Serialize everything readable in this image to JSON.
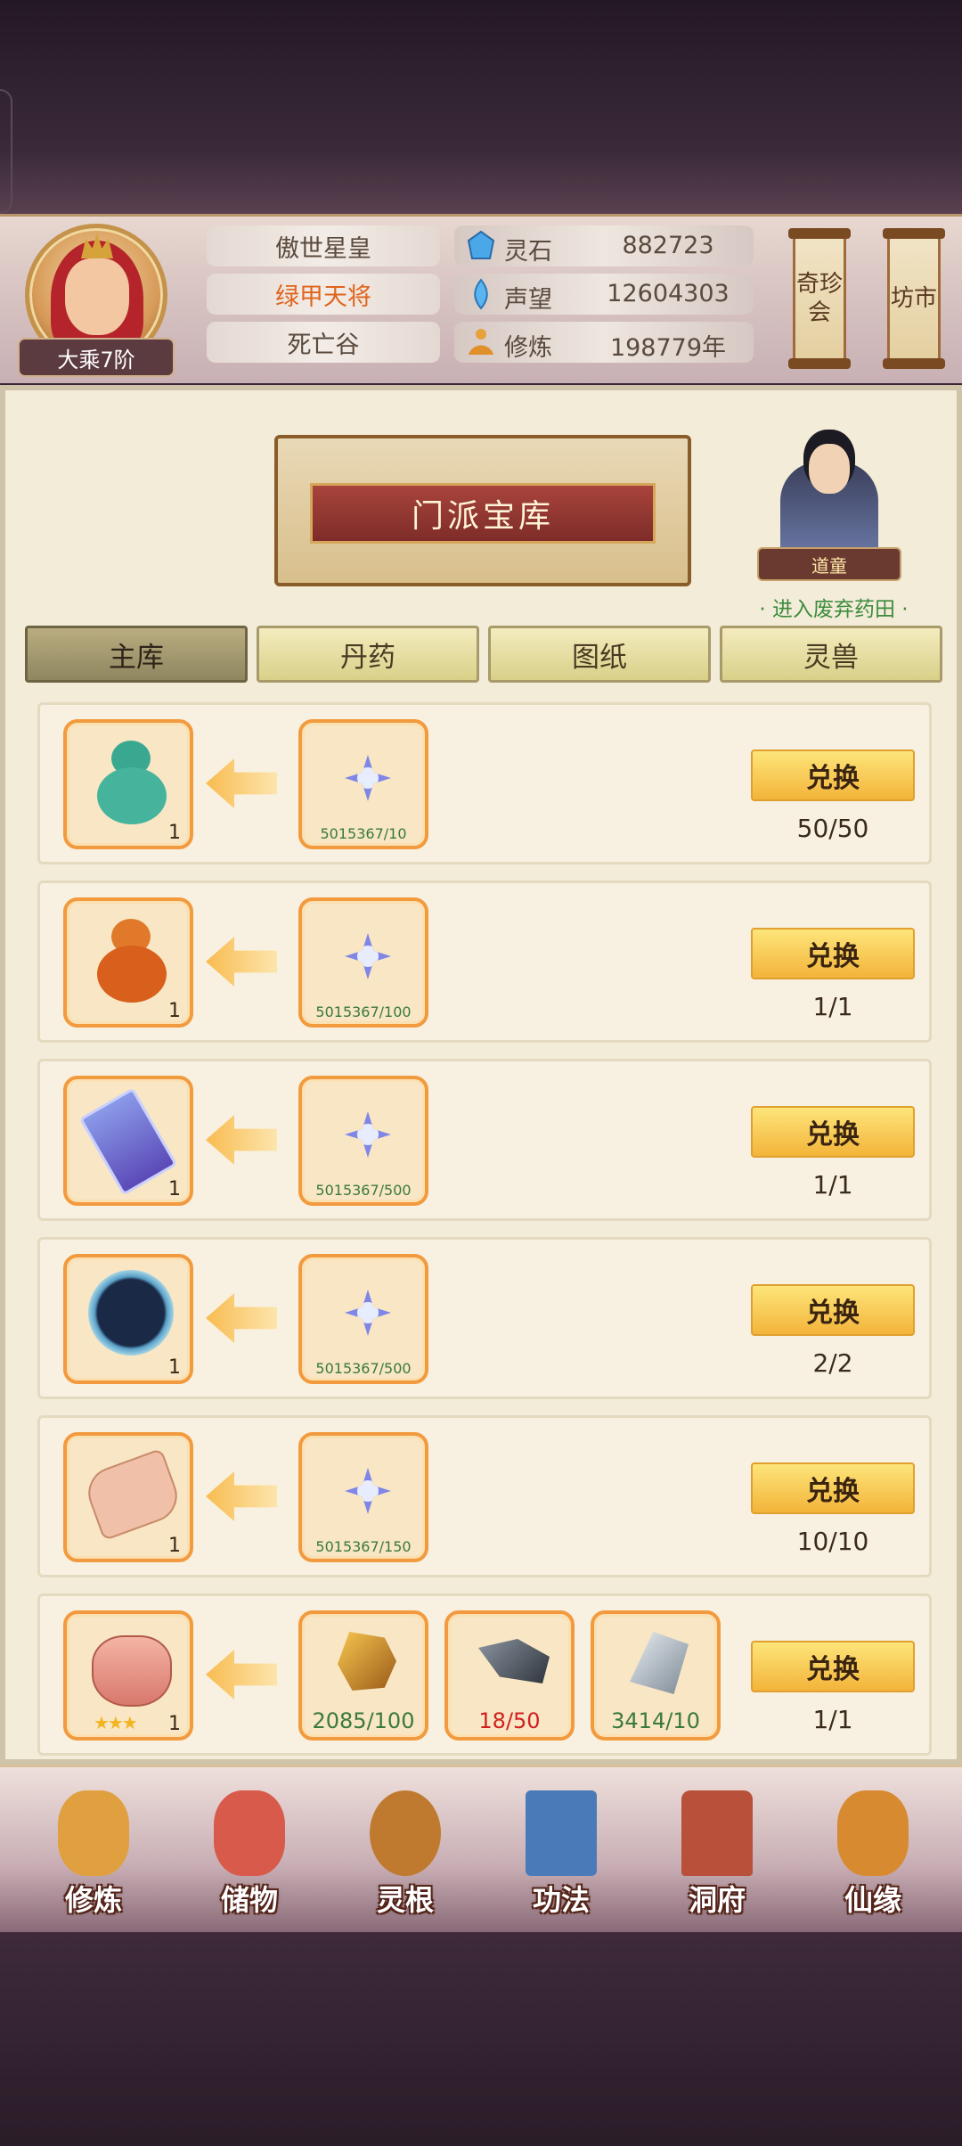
{
  "player": {
    "rank": "大乘7阶",
    "name": "傲世星皇",
    "title": "绿甲天将",
    "location": "死亡谷"
  },
  "stats": [
    {
      "label": "灵石",
      "value": "882723",
      "icon": "spirit-stone-icon"
    },
    {
      "label": "声望",
      "value": "12604303",
      "icon": "reputation-icon"
    },
    {
      "label": "修炼",
      "value": "198779年",
      "icon": "cultivation-icon"
    }
  ],
  "side_buttons": [
    {
      "label": "奇珍会"
    },
    {
      "label": "坊市"
    }
  ],
  "vault": {
    "title": "门派宝库",
    "npc_name": "道童",
    "npc_link": "· 进入废弃药田 ·"
  },
  "tabs": [
    {
      "label": "主库",
      "active": true
    },
    {
      "label": "丹药",
      "active": false
    },
    {
      "label": "图纸",
      "active": false
    },
    {
      "label": "灵兽",
      "active": false
    }
  ],
  "exchange_label": "兑换",
  "rows": [
    {
      "reward_icon": "green-gourd-icon",
      "reward_qty": "1",
      "costs": [
        {
          "icon": "star-shuriken-icon",
          "text": "5015367/10",
          "style": "small"
        }
      ],
      "count": "50/50"
    },
    {
      "reward_icon": "orange-gourd-icon",
      "reward_qty": "1",
      "costs": [
        {
          "icon": "star-shuriken-icon",
          "text": "5015367/100",
          "style": "small"
        }
      ],
      "count": "1/1"
    },
    {
      "reward_icon": "jade-talisman-icon",
      "reward_qty": "1",
      "costs": [
        {
          "icon": "star-shuriken-icon",
          "text": "5015367/500",
          "style": "small"
        }
      ],
      "count": "1/1"
    },
    {
      "reward_icon": "star-disc-icon",
      "reward_qty": "1",
      "costs": [
        {
          "icon": "star-shuriken-icon",
          "text": "5015367/500",
          "style": "small"
        }
      ],
      "count": "2/2"
    },
    {
      "reward_icon": "scroll-icon",
      "reward_qty": "1",
      "costs": [
        {
          "icon": "star-shuriken-icon",
          "text": "5015367/150",
          "style": "small"
        }
      ],
      "count": "10/10"
    },
    {
      "reward_icon": "cauldron-icon",
      "reward_qty": "1",
      "reward_stars": "★★★",
      "costs": [
        {
          "icon": "gold-ore-icon",
          "text": "2085/100",
          "style": "big"
        },
        {
          "icon": "dark-ore-icon",
          "text": "18/50",
          "style": "big-red"
        },
        {
          "icon": "silver-ore-icon",
          "text": "3414/10",
          "style": "big"
        }
      ],
      "count": "1/1"
    }
  ],
  "nav": [
    {
      "label": "修炼",
      "icon": "meditating-monk-icon",
      "color": "#e0a040"
    },
    {
      "label": "储物",
      "icon": "storage-bag-icon",
      "color": "#d85a4a"
    },
    {
      "label": "灵根",
      "icon": "spirit-root-icon",
      "color": "#c07a30"
    },
    {
      "label": "功法",
      "icon": "technique-book-icon",
      "color": "#4a7ab8"
    },
    {
      "label": "洞府",
      "icon": "cave-mansion-icon",
      "color": "#b8503a"
    },
    {
      "label": "仙缘",
      "icon": "immortal-gourd-icon",
      "color": "#d88a30"
    }
  ]
}
